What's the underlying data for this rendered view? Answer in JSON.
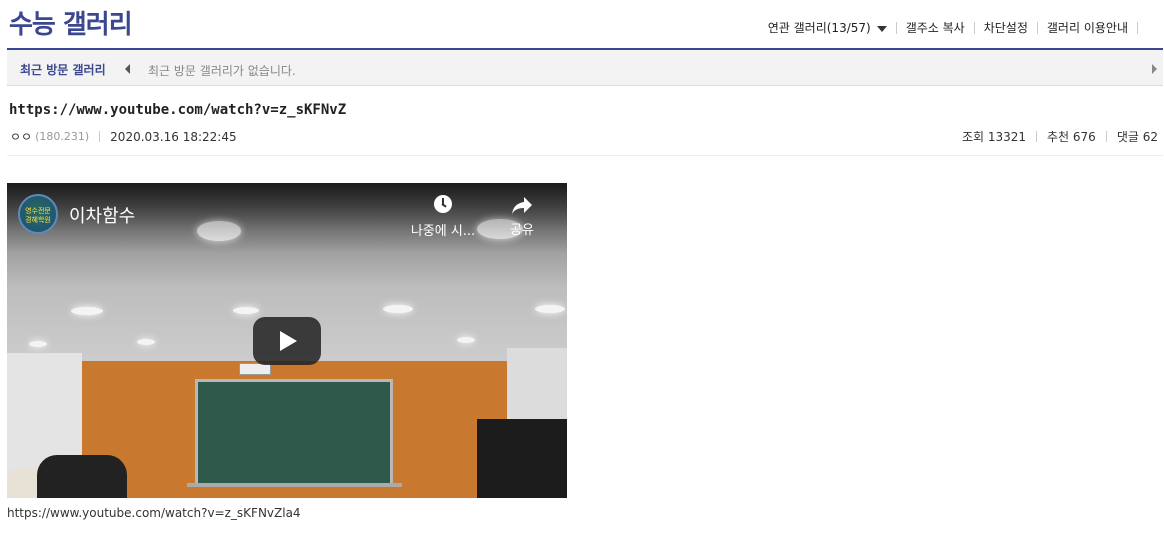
{
  "header": {
    "gallery_title": "수능 갤러리",
    "links": {
      "related": "연관 갤러리(13/57)",
      "copy_address": "갤주소 복사",
      "block_settings": "차단설정",
      "guide": "갤러리 이용안내"
    }
  },
  "recent_visit": {
    "label": "최근 방문 갤러리",
    "empty_text": "최근 방문 갤러리가 없습니다."
  },
  "post": {
    "title": "https://www.youtube.com/watch?v=z_sKFNvZ",
    "author": "ㅇㅇ",
    "ip": "(180.231)",
    "date": "2020.03.16 18:22:45",
    "views": "조회 13321",
    "recommends": "추천 676",
    "comments": "댓글 62"
  },
  "video": {
    "channel_avatar_text": "영수전문\n경혜학원",
    "title": "이차함수",
    "watch_later": "나중에 시...",
    "share": "공유",
    "caption": "https://www.youtube.com/watch?v=z_sKFNvZla4"
  },
  "icons": {
    "dropdown": "chevron-down-icon",
    "prev": "arrow-left-icon",
    "next": "arrow-right-icon",
    "watch_later": "clock-icon",
    "share": "share-icon",
    "play": "play-icon"
  },
  "colors": {
    "brand": "#3b4890",
    "bar_background": "#f3f3f3"
  }
}
